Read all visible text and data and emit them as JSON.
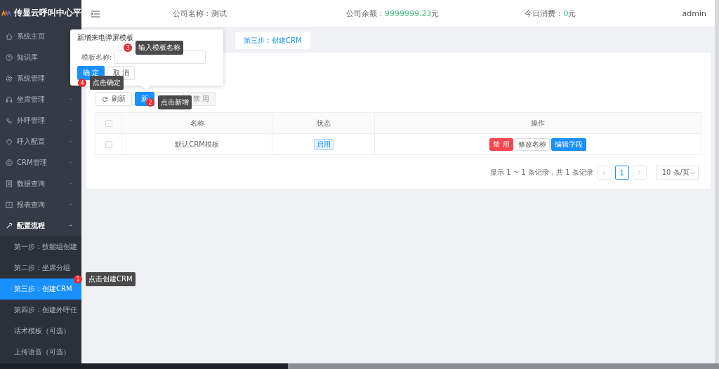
{
  "brand": {
    "title": "传显云呼叫中心平"
  },
  "sidebar": {
    "items": [
      {
        "label": "系统主页"
      },
      {
        "label": "知识库"
      },
      {
        "label": "系统管理"
      },
      {
        "label": "坐席管理",
        "expanded": false
      },
      {
        "label": "外呼管理",
        "expanded": false
      },
      {
        "label": "呼入配置",
        "expanded": false
      },
      {
        "label": "CRM管理",
        "expanded": false
      },
      {
        "label": "数据查询",
        "expanded": false
      },
      {
        "label": "报表查询",
        "expanded": false
      },
      {
        "label": "配置流程",
        "expanded": true,
        "children": [
          {
            "label": "第一步：技能组创建",
            "selected": false
          },
          {
            "label": "第二步：坐席分组",
            "selected": false
          },
          {
            "label": "第三步：创建CRM",
            "selected": true
          },
          {
            "label": "第四步：创建外呼任",
            "selected": false
          },
          {
            "label": "话术模板（可选）",
            "selected": false
          },
          {
            "label": "上传语音（可选）",
            "selected": false
          }
        ]
      }
    ]
  },
  "header": {
    "company_label": "公司名称：",
    "company_name": "测试",
    "balance_label": "公司余额：",
    "balance_value": "9999999.23",
    "balance_unit": "元",
    "spend_label": "今日消费：",
    "spend_value": "0",
    "spend_unit": "元",
    "user": "admin"
  },
  "tabs": [
    {
      "label": "第三步：创建CRM",
      "selected": true
    }
  ],
  "toolbar": [
    {
      "kind": "refresh",
      "label": "刷新"
    },
    {
      "kind": "primary",
      "label": "新"
    },
    {
      "kind": "covered"
    },
    {
      "kind": "default",
      "label": "禁 用",
      "disabled": true
    }
  ],
  "table": {
    "all_checked": false,
    "columns": [
      "名称",
      "状态",
      "操作"
    ],
    "rows": [
      {
        "checked": false,
        "name": "默认CRM模板",
        "status": "启用",
        "actions": [
          {
            "kind": "danger",
            "label": "禁 用"
          },
          {
            "kind": "default",
            "label": "修改名称"
          },
          {
            "kind": "primary",
            "label": "编辑字段"
          }
        ]
      }
    ]
  },
  "pagination": {
    "summary": "显示 1 ~ 1 条记录，共 1 条记录",
    "pages": [
      {
        "label": "1",
        "selected": true
      }
    ],
    "page_size": "10 条/页"
  },
  "popover": {
    "title": "新增来电弹屏模板",
    "field_label": "模板名称:",
    "buttons": [
      {
        "kind": "primary",
        "label": "确 定"
      },
      {
        "kind": "default",
        "label": "取 消"
      }
    ]
  },
  "annotations": [
    {
      "number": "3",
      "text": "输入模板名称"
    },
    {
      "number": "4",
      "text": "点击确定"
    },
    {
      "number": "2",
      "text": "点击新增"
    },
    {
      "number": "1",
      "text": "点击创建CRM"
    }
  ]
}
